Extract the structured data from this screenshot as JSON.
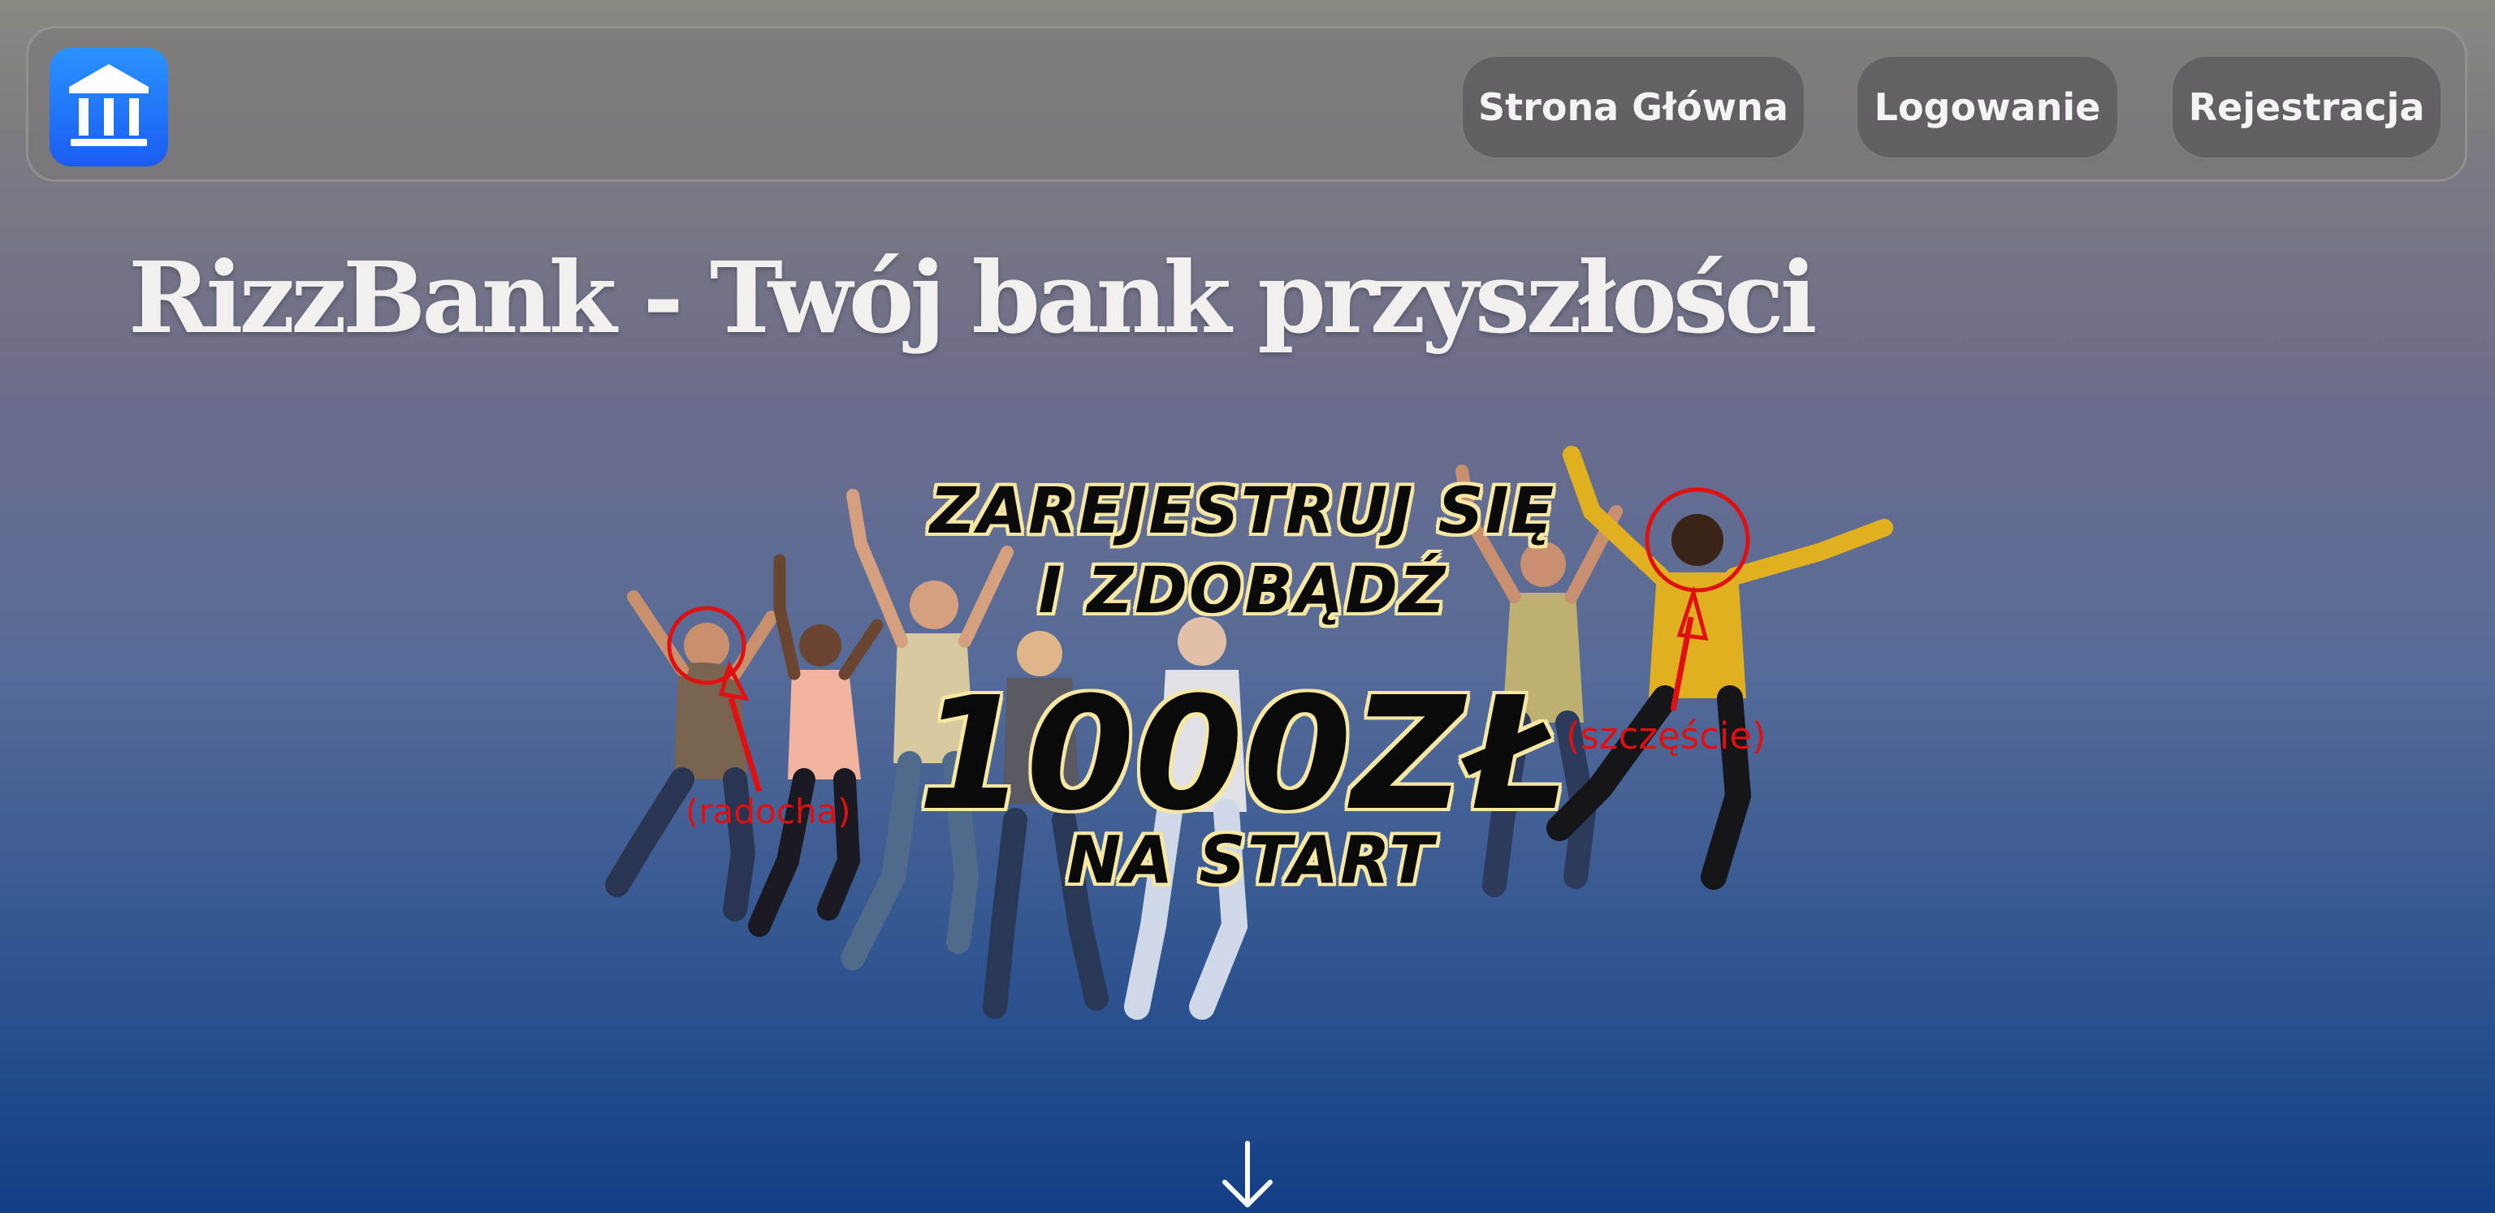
{
  "header": {
    "logo_icon": "bank-building-icon",
    "nav": {
      "home_label": "Strona Główna",
      "login_label": "Logowanie",
      "register_label": "Rejestracja"
    }
  },
  "hero": {
    "title": "RizzBank - Twój bank przyszłości",
    "promo": {
      "line1": "ZAREJESTRUJ SIĘ",
      "line2": "I ZDOBĄDŹ",
      "amount": "1000ZŁ",
      "line4": "NA START",
      "annotation_left": "(radocha)",
      "annotation_right": "(szczęście)"
    },
    "scroll_icon": "arrow-down-icon"
  },
  "colors": {
    "accent_logo": "#1a6cf6",
    "annotation_red": "#e01010",
    "promo_outline": "#f6e7a3"
  }
}
